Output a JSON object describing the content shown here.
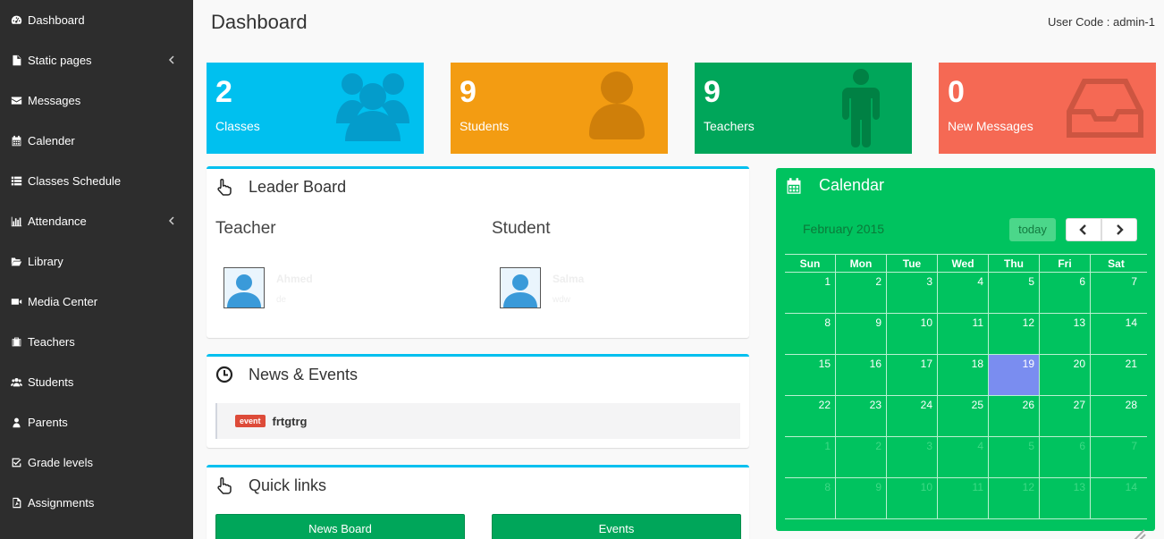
{
  "sidebar": {
    "items": [
      {
        "label": "Dashboard",
        "icon": "dashboard-icon",
        "submenu": false
      },
      {
        "label": "Static pages",
        "icon": "file-icon",
        "submenu": true
      },
      {
        "label": "Messages",
        "icon": "envelope-icon",
        "submenu": false
      },
      {
        "label": "Calender",
        "icon": "calendar-icon",
        "submenu": false
      },
      {
        "label": "Classes Schedule",
        "icon": "list-icon",
        "submenu": false
      },
      {
        "label": "Attendance",
        "icon": "bar-chart-icon",
        "submenu": true
      },
      {
        "label": "Library",
        "icon": "folder-open-icon",
        "submenu": false
      },
      {
        "label": "Media Center",
        "icon": "video-camera-icon",
        "submenu": false
      },
      {
        "label": "Teachers",
        "icon": "suitcase-icon",
        "submenu": false
      },
      {
        "label": "Students",
        "icon": "users-icon",
        "submenu": false
      },
      {
        "label": "Parents",
        "icon": "user-icon",
        "submenu": false
      },
      {
        "label": "Grade levels",
        "icon": "check-square-icon",
        "submenu": false
      },
      {
        "label": "Assignments",
        "icon": "file-pdf-icon",
        "submenu": false
      }
    ]
  },
  "header": {
    "title": "Dashboard",
    "user_code": "User Code : admin-1"
  },
  "stats": [
    {
      "value": "2",
      "label": "Classes",
      "color": "#00c0ef",
      "icon": "users-icon"
    },
    {
      "value": "9",
      "label": "Students",
      "color": "#f39c12",
      "icon": "user-icon"
    },
    {
      "value": "9",
      "label": "Teachers",
      "color": "#00a65a",
      "icon": "male-icon"
    },
    {
      "value": "0",
      "label": "New Messages",
      "color": "#f56954",
      "icon": "inbox-icon"
    }
  ],
  "leaderboard": {
    "title": "Leader Board",
    "teacher": {
      "heading": "Teacher",
      "name": "Ahmed",
      "sub": "de"
    },
    "student": {
      "heading": "Student",
      "name": "Salma",
      "sub": "wdw"
    }
  },
  "news": {
    "title": "News & Events",
    "items": [
      {
        "badge": "event",
        "text": "frtgtrg"
      }
    ]
  },
  "quicklinks": {
    "title": "Quick links",
    "buttons": [
      "News Board",
      "Events"
    ]
  },
  "calendar": {
    "title": "Calendar",
    "month": "February 2015",
    "today_label": "today",
    "weekdays": [
      "Sun",
      "Mon",
      "Tue",
      "Wed",
      "Thu",
      "Fri",
      "Sat"
    ],
    "weeks": [
      [
        "1",
        "2",
        "3",
        "4",
        "5",
        "6",
        "7"
      ],
      [
        "8",
        "9",
        "10",
        "11",
        "12",
        "13",
        "14"
      ],
      [
        "15",
        "16",
        "17",
        "18",
        "19",
        "20",
        "21"
      ],
      [
        "22",
        "23",
        "24",
        "25",
        "26",
        "27",
        "28"
      ],
      [
        "1",
        "2",
        "3",
        "4",
        "5",
        "6",
        "7"
      ],
      [
        "8",
        "9",
        "10",
        "11",
        "12",
        "13",
        "14"
      ]
    ],
    "current_month_weeks": 4,
    "today": "19",
    "colors": {
      "background": "#00c35f",
      "today": "#7a8df0"
    }
  }
}
